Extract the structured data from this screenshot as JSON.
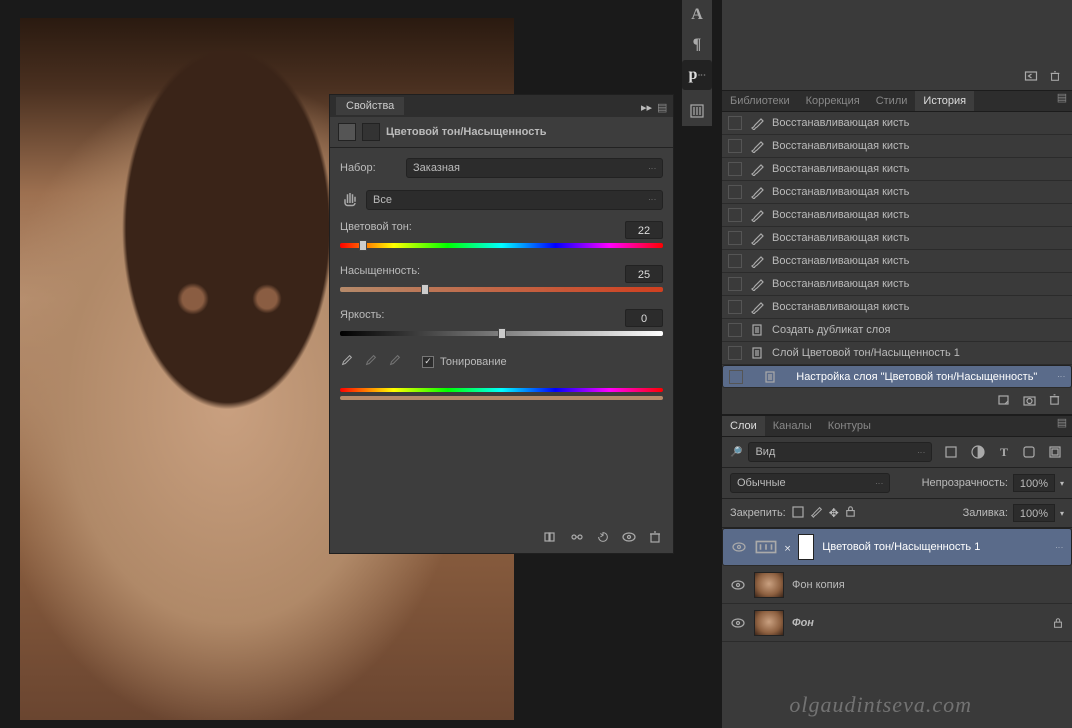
{
  "watermark": "olgaudintseva.com",
  "type_tools": [
    "A",
    "¶",
    "p"
  ],
  "properties": {
    "title": "Свойства",
    "subtitle": "Цветовой тон/Насыщенность",
    "preset": {
      "label": "Набор:",
      "value": "Заказная"
    },
    "channel": {
      "value": "Все"
    },
    "hue": {
      "label": "Цветовой тон:",
      "value": "22"
    },
    "saturation": {
      "label": "Насыщенность:",
      "value": "25"
    },
    "lightness": {
      "label": "Яркость:",
      "value": "0"
    },
    "colorize": {
      "label": "Тонирование",
      "checked": true
    }
  },
  "panel_tabs": {
    "libraries": "Библиотеки",
    "adjustments": "Коррекция",
    "styles": "Стили",
    "history": "История"
  },
  "history_items": [
    {
      "icon": "brush",
      "label": "Восстанавливающая кисть"
    },
    {
      "icon": "brush",
      "label": "Восстанавливающая кисть"
    },
    {
      "icon": "brush",
      "label": "Восстанавливающая кисть"
    },
    {
      "icon": "brush",
      "label": "Восстанавливающая кисть"
    },
    {
      "icon": "brush",
      "label": "Восстанавливающая кисть"
    },
    {
      "icon": "brush",
      "label": "Восстанавливающая кисть"
    },
    {
      "icon": "brush",
      "label": "Восстанавливающая кисть"
    },
    {
      "icon": "brush",
      "label": "Восстанавливающая кисть"
    },
    {
      "icon": "brush",
      "label": "Восстанавливающая кисть"
    },
    {
      "icon": "doc",
      "label": "Создать дубликат слоя"
    },
    {
      "icon": "doc",
      "label": "Слой Цветовой тон/Насыщенность 1"
    },
    {
      "icon": "doc",
      "label": "Настройка слоя \"Цветовой тон/Насыщенность\"",
      "selected": true
    }
  ],
  "layers_panel": {
    "tabs": {
      "layers": "Слои",
      "channels": "Каналы",
      "paths": "Контуры"
    },
    "filter_label": "Вид",
    "blend": {
      "label": "Обычные"
    },
    "opacity": {
      "label": "Непрозрачность:",
      "value": "100%"
    },
    "lock_label": "Закрепить:",
    "fill": {
      "label": "Заливка:",
      "value": "100%"
    },
    "layers": [
      {
        "name": "Цветовой тон/Насыщенность 1",
        "type": "adjustment",
        "selected": true
      },
      {
        "name": "Фон копия",
        "type": "image"
      },
      {
        "name": "Фон",
        "type": "image",
        "locked": true,
        "italic": true
      }
    ]
  },
  "chart_data": {
    "type": "bar",
    "note": "Hue/Saturation adjustment sliders treated as data points",
    "sliders": [
      {
        "name": "Цветовой тон",
        "min": -180,
        "max": 180,
        "value": 22
      },
      {
        "name": "Насыщенность",
        "min": -100,
        "max": 100,
        "value": 25
      },
      {
        "name": "Яркость",
        "min": -100,
        "max": 100,
        "value": 0
      }
    ],
    "colorize": true
  }
}
